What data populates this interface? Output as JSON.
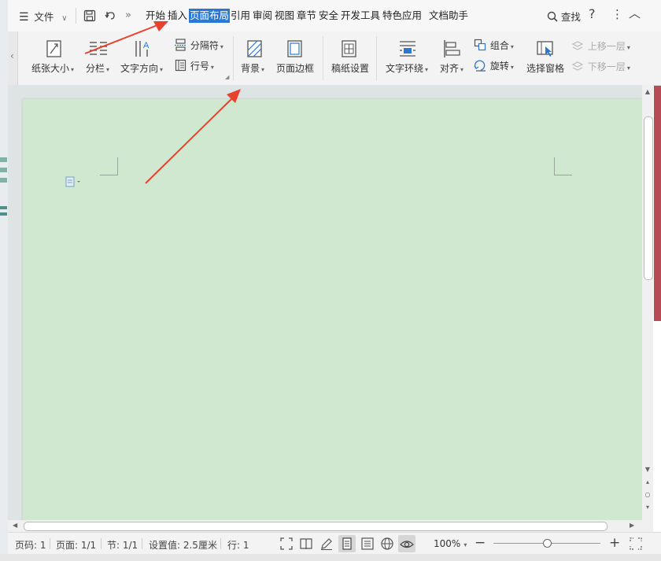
{
  "menubar": {
    "file_label": "文件",
    "tabs": [
      {
        "label": "开始"
      },
      {
        "label": "插入"
      },
      {
        "label": "页面布局",
        "active": true
      },
      {
        "label": "引用"
      },
      {
        "label": "审阅"
      },
      {
        "label": "视图"
      },
      {
        "label": "章节"
      },
      {
        "label": "安全"
      },
      {
        "label": "开发工具"
      },
      {
        "label": "特色应用"
      },
      {
        "label": "文档助手"
      }
    ],
    "search_label": "查找",
    "help_glyph": "?",
    "more_glyph": "⋮",
    "collapse_glyph": "︿",
    "expand_glyph": "»"
  },
  "ribbon": {
    "paper_size": "纸张大小",
    "columns": "分栏",
    "text_direction": "文字方向",
    "separator": "分隔符",
    "line_number": "行号",
    "background": "背景",
    "page_border": "页面边框",
    "manuscript": "稿纸设置",
    "text_wrap": "文字环绕",
    "align": "对齐",
    "group": "组合",
    "rotate": "旋转",
    "select_pane": "选择窗格",
    "bring_forward": "上移一层",
    "send_backward": "下移一层",
    "caret": "▾",
    "scroll_left": "‹"
  },
  "statusbar": {
    "page_num": "页码: 1",
    "pages": "页面: 1/1",
    "section": "节: 1/1",
    "setting": "设置值: 2.5厘米",
    "line": "行: 1",
    "zoom": "100%",
    "zoom_caret": "▾",
    "minus": "−",
    "plus": "+",
    "zoom_fraction": 0.5
  },
  "colors": {
    "accent": "#2b78d4",
    "page_bg": "#cfe8cf",
    "arrow": "#e8412c"
  }
}
